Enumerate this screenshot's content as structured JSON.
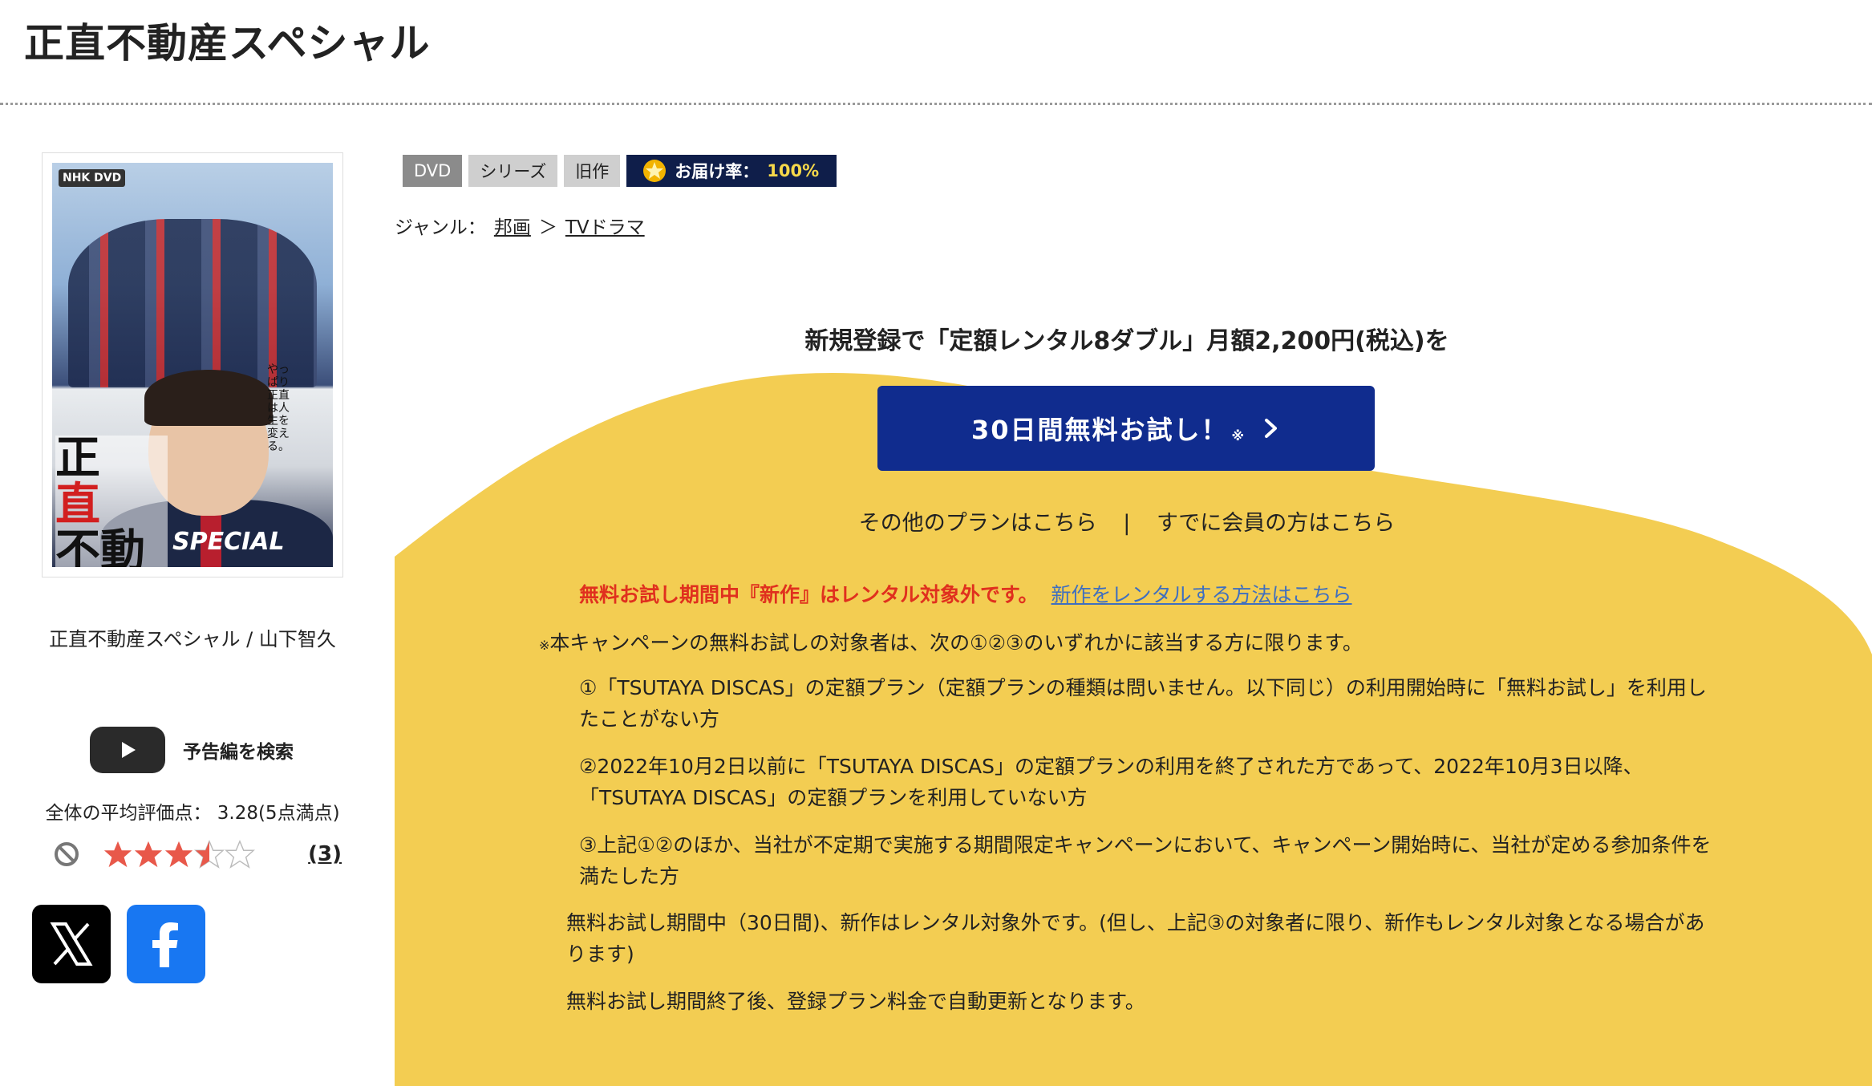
{
  "page": {
    "title": "正直不動産スペシャル"
  },
  "product": {
    "caption": "正直不動産スペシャル / 山下智久",
    "cover": {
      "logo": "NHK DVD",
      "title_line1": "正",
      "title_line2": "直",
      "title_line3": "不動産",
      "special": "SPECIAL",
      "tagline": "やっぱり正直は人生を変える。"
    }
  },
  "trailer": {
    "label": "予告編を検索"
  },
  "rating": {
    "summary": "全体の平均評価点： 3.28(5点満点)",
    "count": "(3)",
    "score": 3.28,
    "max": 5
  },
  "tags": {
    "dvd": "DVD",
    "series": "シリーズ",
    "old": "旧作",
    "delivery_label": "お届け率：",
    "delivery_value": "100%"
  },
  "genre": {
    "label": "ジャンル：",
    "level1": "邦画",
    "sep": "＞",
    "level2": "TVドラマ"
  },
  "campaign": {
    "headline": "新規登録で「定額レンタル8ダブル」月額2,200円(税込)を",
    "cta_label": "30日間無料お試し！",
    "cta_note": "※",
    "other_plans": "その他のプランはこちら",
    "sep": "|",
    "member": "すでに会員の方はこちら",
    "notice_red": "無料お試し期間中『新作』はレンタル対象外です。",
    "notice_link": "新作をレンタルする方法はこちら",
    "terms_mark": "※",
    "terms_head": "本キャンペーンの無料お試しの対象者は、次の①②③のいずれかに該当する方に限ります。",
    "term1": "①「TSUTAYA DISCAS」の定額プラン（定額プランの種類は問いません。以下同じ）の利用開始時に「無料お試し」を利用したことがない方",
    "term2": "②2022年10月2日以前に「TSUTAYA DISCAS」の定額プランの利用を終了された方であって、2022年10月3日以降、「TSUTAYA DISCAS」の定額プランを利用していない方",
    "term3": "③上記①②のほか、当社が不定期で実施する期間限定キャンペーンにおいて、キャンペーン開始時に、当社が定める参加条件を満たした方",
    "note1": "無料お試し期間中（30日間)、新作はレンタル対象外です。(但し、上記③の対象者に限り、新作もレンタル対象となる場合があります)",
    "note2": "無料お試し期間終了後、登録プラン料金で自動更新となります。"
  },
  "colors": {
    "campaign_yellow": "#f3cd52",
    "cta_blue": "#102c8e",
    "delivery_navy": "#0f1e4a",
    "notice_red": "#e0301e",
    "link_blue": "#3f6fbf"
  },
  "icons": [
    "play-icon",
    "no-rating-icon",
    "star-icon",
    "x-logo-icon",
    "facebook-logo-icon",
    "gold-star-icon",
    "chevron-right-icon"
  ]
}
